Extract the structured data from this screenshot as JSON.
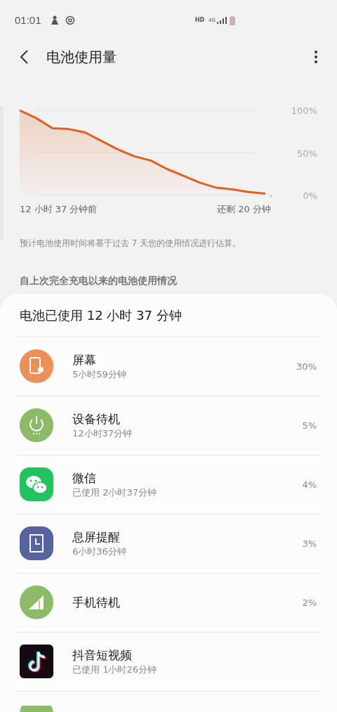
{
  "status_bar": {
    "time": "01:01",
    "hd": "HD",
    "network": "4G"
  },
  "header": {
    "title": "电池使用量"
  },
  "chart": {
    "start_label": "12 小时 37 分钟前",
    "end_label": "还剩 20 分钟",
    "chart_data": {
      "type": "area",
      "ylim": [
        0,
        100
      ],
      "yticks": [
        {
          "value": 0,
          "label": "0%"
        },
        {
          "value": 50,
          "label": "50%"
        },
        {
          "value": 100,
          "label": "100%"
        }
      ],
      "series": [
        {
          "color": "#e0601f",
          "values": [
            100,
            91,
            79,
            78,
            74,
            64,
            54,
            46,
            41,
            31,
            23,
            15,
            9,
            7,
            4,
            2
          ]
        }
      ]
    }
  },
  "note": "预计电池使用时间将基于过去 7 天您的使用情况进行估算。",
  "section_title": "自上次完全充电以来的电池使用情况",
  "usage": {
    "title": "电池已使用 12 小时 37 分钟",
    "items": [
      {
        "kind": "screen",
        "name": "屏幕",
        "detail": "5小时59分钟",
        "percent": "30%"
      },
      {
        "kind": "power",
        "name": "设备待机",
        "detail": "12小时37分钟",
        "percent": "5%"
      },
      {
        "kind": "chat",
        "name": "微信",
        "detail": "已使用 2小时37分钟",
        "percent": "4%"
      },
      {
        "kind": "clock",
        "name": "息屏提醒",
        "detail": "6小时36分钟",
        "percent": "3%"
      },
      {
        "kind": "signal",
        "name": "手机待机",
        "percent": "2%"
      },
      {
        "kind": "music",
        "name": "抖音短视频",
        "detail": "已使用 1小时26分钟"
      },
      {
        "kind": "partial"
      }
    ]
  }
}
